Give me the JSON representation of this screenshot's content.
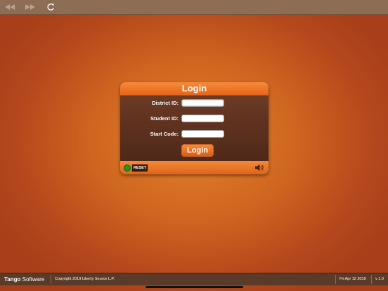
{
  "toolbar": {
    "icons": [
      "back-icon",
      "forward-icon",
      "reload-icon"
    ]
  },
  "login": {
    "title": "Login",
    "fields": [
      {
        "label": "District ID:",
        "value": "",
        "placeholder": ""
      },
      {
        "label": "Student ID:",
        "value": "",
        "placeholder": ""
      },
      {
        "label": "Start Code:",
        "value": "",
        "placeholder": ""
      }
    ],
    "submit_label": "Login",
    "reset_label": "RESET",
    "status_color": "#1d9a18"
  },
  "footer": {
    "brand_bold": "Tango",
    "brand_rest": " Software",
    "copyright": "Copyright 2019 Liberty Source L.P.",
    "date": "Fri Apr 12 2019",
    "version": "v 1.0"
  },
  "colors": {
    "accent": "#e86d22",
    "panel": "#5c2f1e",
    "toolbar": "#8d6e55"
  }
}
